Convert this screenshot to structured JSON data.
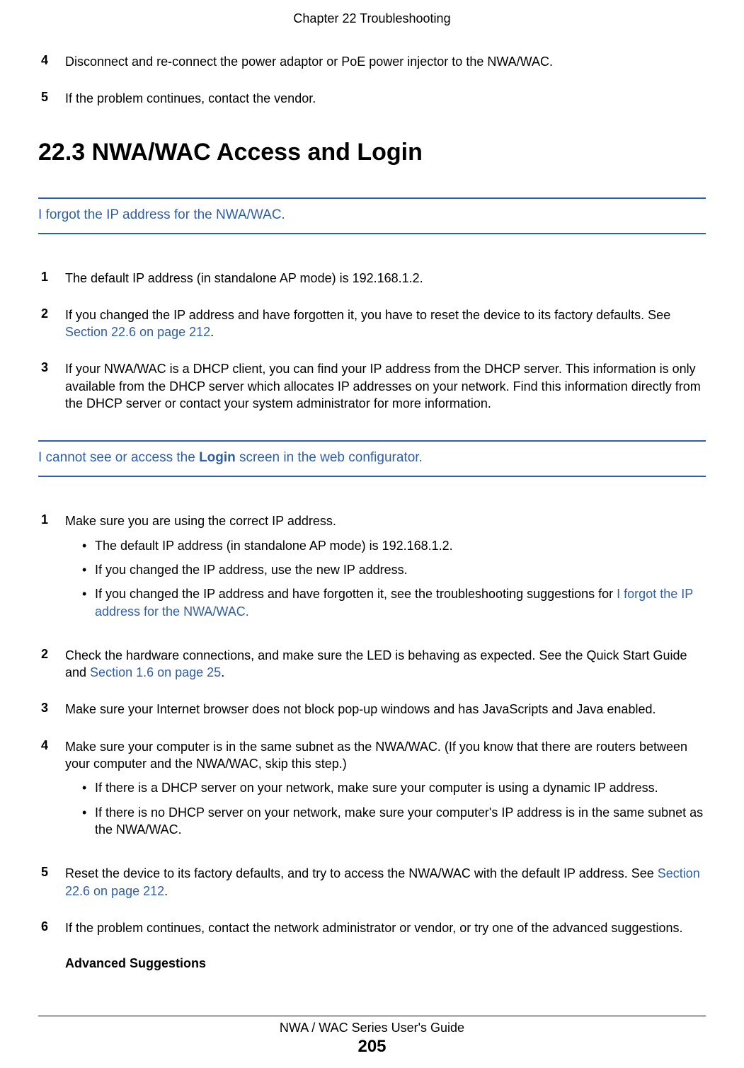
{
  "header": {
    "chapter": "Chapter 22 Troubleshooting"
  },
  "top_steps": {
    "s4": {
      "num": "4",
      "text": "Disconnect and re-connect the power adaptor or PoE power injector to the NWA/WAC."
    },
    "s5": {
      "num": "5",
      "text": "If the problem continues, contact the vendor."
    }
  },
  "section": {
    "title": "22.3  NWA/WAC Access and Login"
  },
  "topic1": {
    "heading": "I forgot the IP address for the NWA/WAC.",
    "steps": {
      "s1": {
        "num": "1",
        "text": "The default IP address (in standalone AP mode) is 192.168.1.2."
      },
      "s2": {
        "num": "2",
        "pre": "If you changed the IP address and have forgotten it, you have to reset the device to its factory defaults. See ",
        "link": "Section 22.6 on page 212",
        "post": "."
      },
      "s3": {
        "num": "3",
        "text": "If your NWA/WAC is a DHCP client, you can find your IP address from the DHCP server. This information is only available from the DHCP server which allocates IP addresses on your network. Find this information directly from the DHCP server or contact your system administrator for more information."
      }
    }
  },
  "topic2": {
    "heading_pre": "I cannot see or access the ",
    "heading_bold": "Login",
    "heading_post": " screen in the web configurator.",
    "steps": {
      "s1": {
        "num": "1",
        "text": "Make sure you are using the correct IP address.",
        "bullets": {
          "b1": "The default IP address (in standalone AP mode) is 192.168.1.2.",
          "b2": "If you changed the IP address, use the new IP address.",
          "b3_pre": "If you changed the IP address and have forgotten it, see the troubleshooting suggestions for ",
          "b3_link": "I forgot the IP address for the NWA/WAC."
        }
      },
      "s2": {
        "num": "2",
        "pre": "Check the hardware connections, and make sure the LED is behaving as expected. See the Quick Start Guide and ",
        "link": "Section 1.6 on page 25",
        "post": "."
      },
      "s3": {
        "num": "3",
        "text": "Make sure your Internet browser does not block pop-up windows and has JavaScripts and Java enabled."
      },
      "s4": {
        "num": "4",
        "text": "Make sure your computer is in the same subnet as the NWA/WAC. (If you know that there are routers between your computer and the NWA/WAC, skip this step.)",
        "bullets": {
          "b1": "If there is a DHCP server on your network, make sure your computer is using a dynamic IP address.",
          "b2": "If there is no DHCP server on your network, make sure your computer's IP address is in the same subnet as the NWA/WAC."
        }
      },
      "s5": {
        "num": "5",
        "pre": "Reset the device to its factory defaults, and try to access the NWA/WAC with the default IP address. See ",
        "link": "Section 22.6 on page 212",
        "post": "."
      },
      "s6": {
        "num": "6",
        "text": "If the problem continues, contact the network administrator or vendor, or try one of the advanced suggestions."
      }
    },
    "advanced_heading": "Advanced Suggestions"
  },
  "footer": {
    "guide": "NWA / WAC Series User's Guide",
    "page": "205"
  }
}
